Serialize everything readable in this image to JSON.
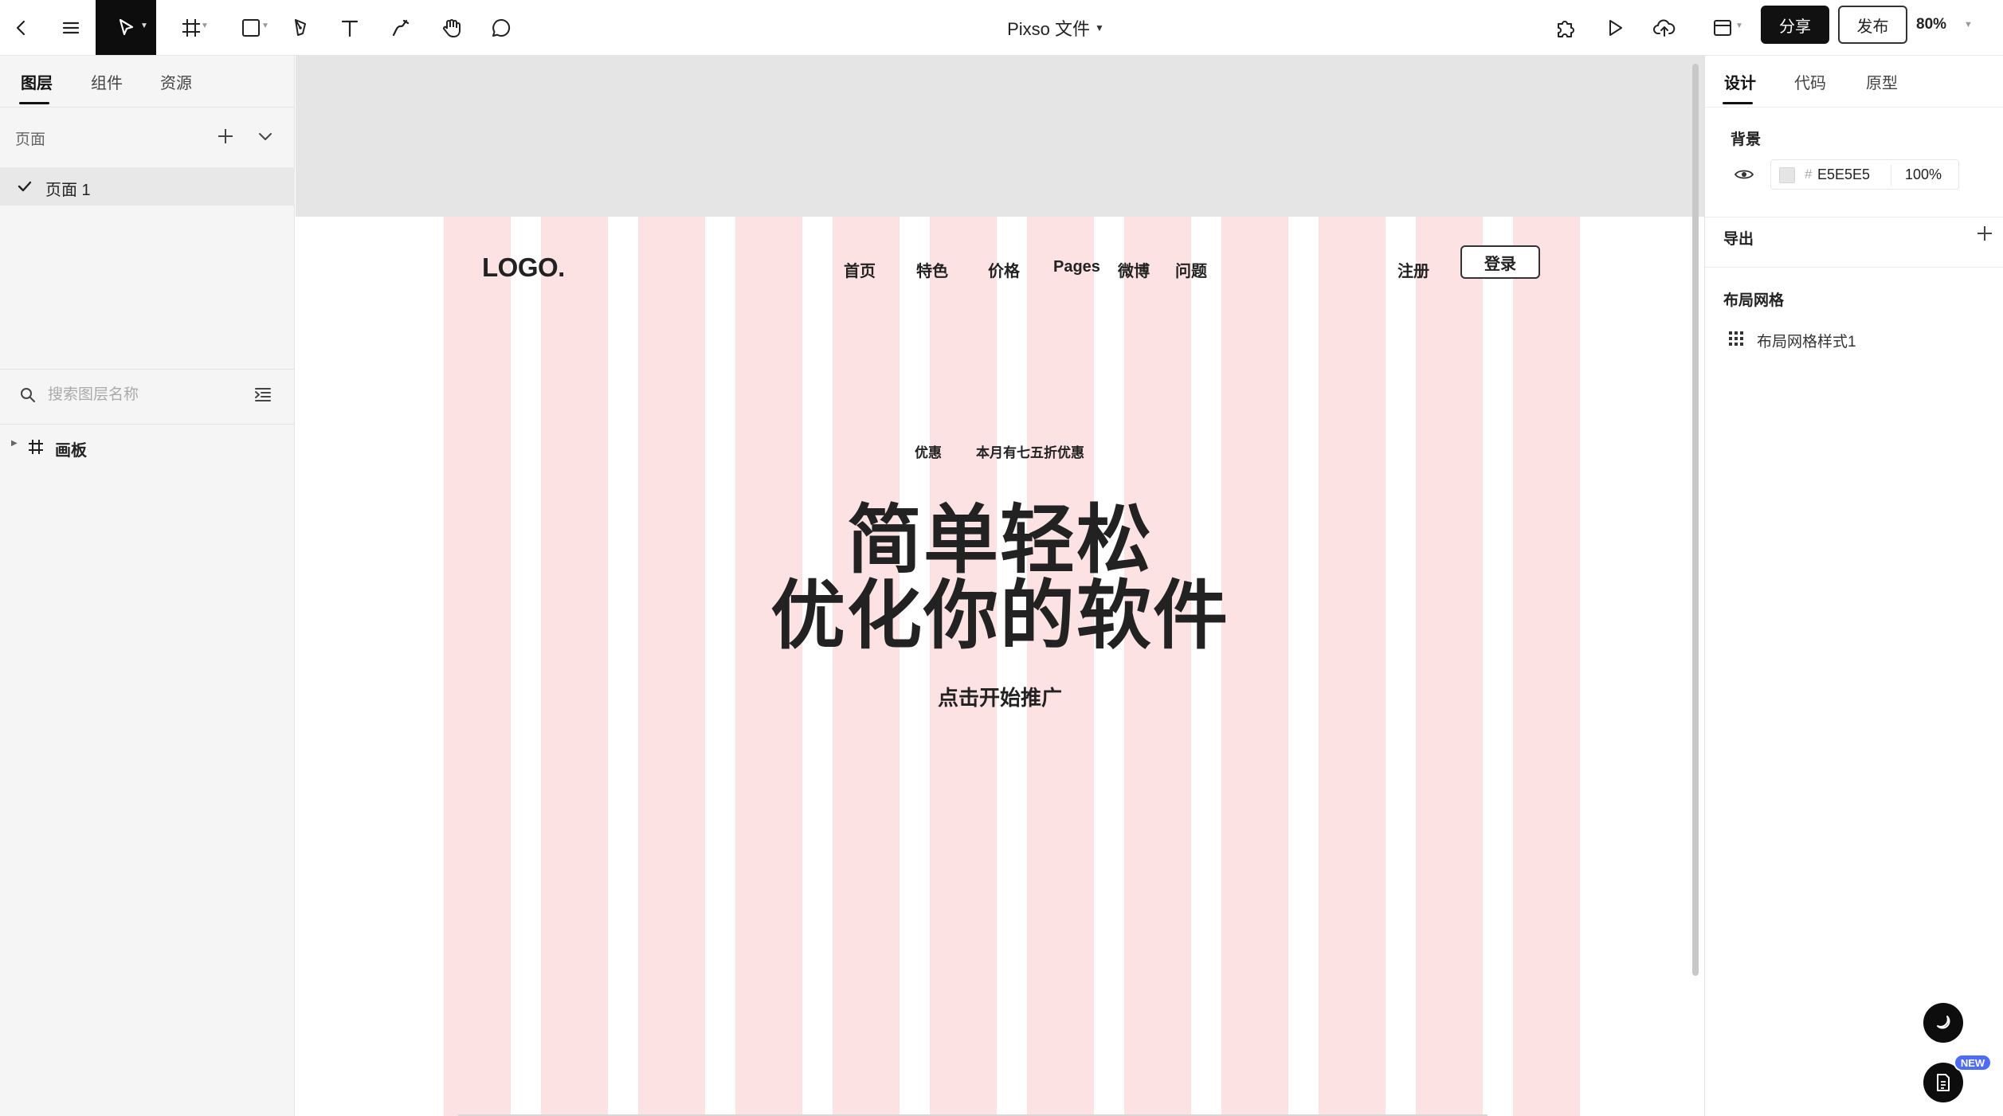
{
  "toolbar": {
    "file_title": "Pixso 文件",
    "share_label": "分享",
    "publish_label": "发布",
    "zoom": "80%",
    "icons": [
      "back-icon",
      "menu-icon",
      "move-tool-icon",
      "frame-tool-icon",
      "shape-tool-icon",
      "pen-tool-icon",
      "text-tool-icon",
      "pencil-tool-icon",
      "hand-tool-icon",
      "comment-tool-icon",
      "plugin-icon",
      "play-icon",
      "upload-icon",
      "layout-icon"
    ]
  },
  "left_panel": {
    "tabs": [
      {
        "label": "图层"
      },
      {
        "label": "组件"
      },
      {
        "label": "资源"
      }
    ],
    "pages_header": "页面",
    "pages": [
      {
        "label": "页面 1",
        "selected": true
      }
    ],
    "search_placeholder": "搜索图层名称",
    "layers": [
      {
        "label": "画板",
        "type": "frame"
      }
    ]
  },
  "canvas": {
    "background": "#E5E5E5",
    "grid_color": "#FDE2E3",
    "site": {
      "logo": "LOGO.",
      "nav": [
        "首页",
        "特色",
        "价格",
        "Pages",
        "微博",
        "问题"
      ],
      "signup": "注册",
      "login": "登录",
      "promo_tag": "优惠",
      "promo_text": "本月有七五折优惠",
      "hero_line1": "简单轻松",
      "hero_line2": "优化你的软件",
      "cta": "点击开始推广"
    }
  },
  "right_panel": {
    "tabs": [
      {
        "label": "设计"
      },
      {
        "label": "代码"
      },
      {
        "label": "原型"
      }
    ],
    "background_title": "背景",
    "bg_hash": "#",
    "bg_hex": "E5E5E5",
    "bg_opacity": "100%",
    "export_title": "导出",
    "layout_grid_title": "布局网格",
    "layout_grid_style": "布局网格样式1",
    "new_badge": "NEW"
  }
}
